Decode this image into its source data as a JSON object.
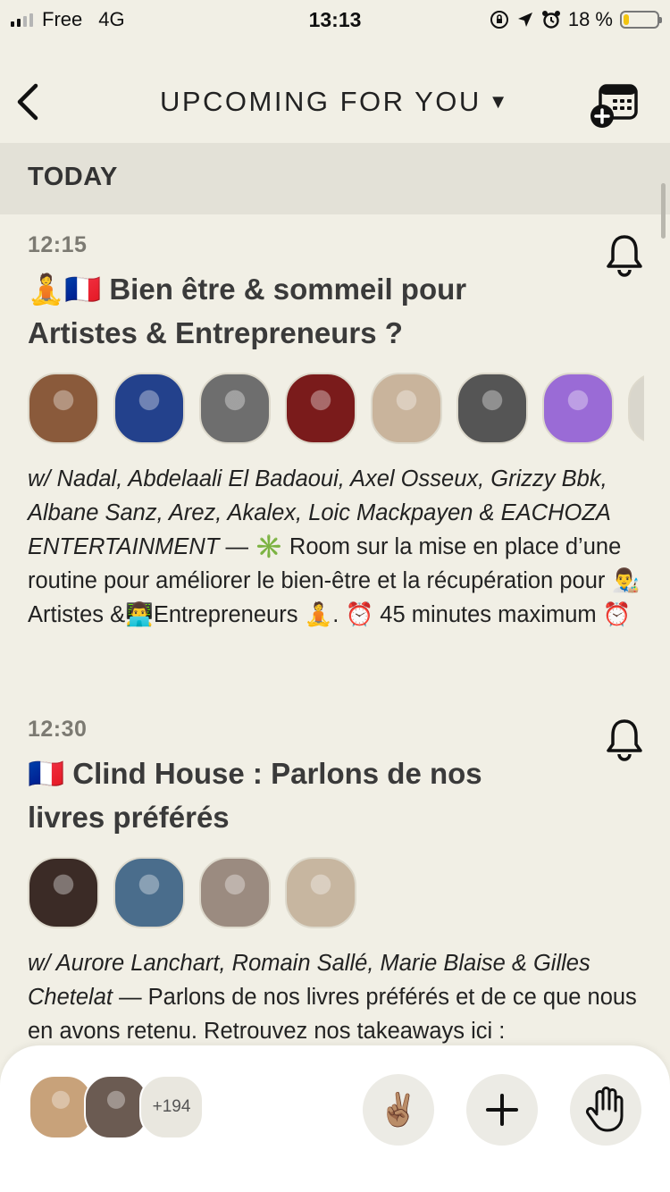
{
  "status_bar": {
    "carrier": "Free",
    "network": "4G",
    "time": "13:13",
    "battery_percent": "18 %",
    "battery_level": 0.18,
    "battery_color": "#f2c40f"
  },
  "header": {
    "title": "UPCOMING FOR YOU",
    "dropdown_glyph": "▼",
    "back_icon": "chevron-left-icon",
    "calendar_icon": "calendar-add-icon"
  },
  "section": {
    "label": "TODAY"
  },
  "events": [
    {
      "time": "12:15",
      "title": "🧘🇫🇷 Bien être & sommeil pour Artistes & Entrepreneurs ?",
      "participants_avatars": [
        "#8a5a3b",
        "#23418c",
        "#6e6e6e",
        "#7a1b1b",
        "#c9b49c",
        "#555555",
        "#9a6bd6",
        "#d9d6cc"
      ],
      "hosts": "w/ Nadal, Abdelaali El Badaoui, Axel Osseux, Grizzy Bbk, Albane Sanz, Arez, Akalex, Loic Mackpayen & EACHOZA ENTERTAINMENT",
      "description": " — ✳️ Room sur la mise en place d’une routine pour améliorer le  bien-être et la récupération pour 👨‍🎨Artistes &👨‍💻Entrepreneurs 🧘. ⏰ 45 minutes maximum ⏰"
    },
    {
      "time": "12:30",
      "title": "🇫🇷 Clind House : Parlons de nos livres préférés",
      "participants_avatars": [
        "#3b2b26",
        "#4a6d8c",
        "#9b8b80",
        "#c7b6a0"
      ],
      "hosts": "w/ Aurore Lanchart, Romain Sallé, Marie Blaise & Gilles Chetelat",
      "description": " — Parlons de nos livres préférés et de ce que nous en avons retenu. Retrouvez nos takeaways ici :"
    }
  ],
  "bottom_bar": {
    "room_avatars": [
      "#c8a27a",
      "#6b5b52"
    ],
    "more_count": "+194",
    "peace_emoji": "✌🏽",
    "add_symbol": "+",
    "hand_icon": "raise-hand-icon"
  }
}
